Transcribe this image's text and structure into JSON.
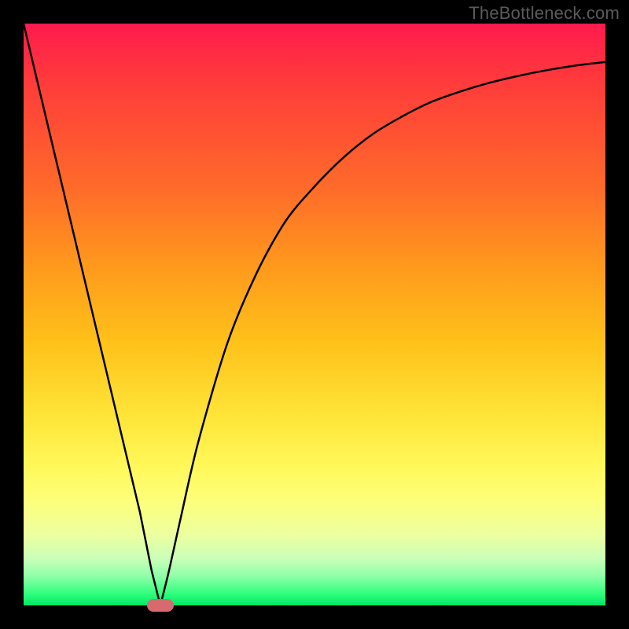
{
  "watermark": "TheBottleneck.com",
  "chart_data": {
    "type": "line",
    "title": "",
    "xlabel": "",
    "ylabel": "",
    "xlim": [
      0,
      100
    ],
    "ylim": [
      0,
      100
    ],
    "grid": false,
    "legend": false,
    "series": [
      {
        "name": "curve",
        "x": [
          0,
          5,
          10,
          15,
          20,
          22,
          23.5,
          25,
          27,
          30,
          35,
          40,
          45,
          50,
          55,
          60,
          65,
          70,
          75,
          80,
          85,
          90,
          95,
          100
        ],
        "y": [
          100,
          79,
          58,
          37,
          16,
          6,
          0,
          6,
          15,
          28,
          45,
          57,
          66,
          72,
          77,
          81,
          84,
          86.5,
          88.3,
          89.8,
          91,
          92,
          92.8,
          93.4
        ]
      }
    ],
    "marker": {
      "x": 23.5,
      "y": 0,
      "shape": "pill",
      "color": "#d76a6f"
    }
  },
  "colors": {
    "curve_stroke": "#000000",
    "marker_fill": "#d76a6f",
    "frame_bg": "#000000"
  }
}
